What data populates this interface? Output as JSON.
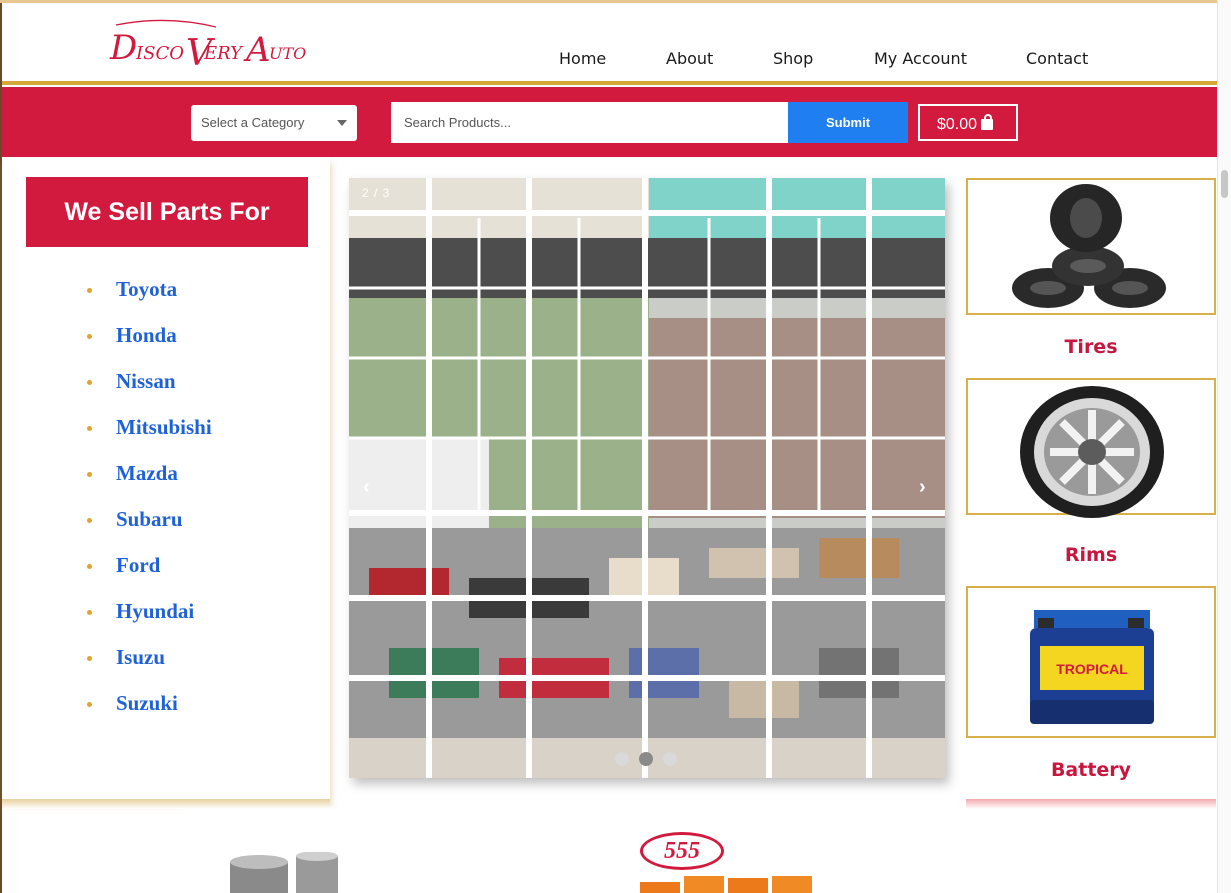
{
  "brand": {
    "logo_text": "DiscoVery Auto",
    "accent": "#d21a3e",
    "gold": "#d4a93a",
    "link": "#1f62d8"
  },
  "nav": {
    "items": [
      "Home",
      "About",
      "Shop",
      "My Account",
      "Contact"
    ]
  },
  "search_bar": {
    "category_select": "Select a Category",
    "search_placeholder": "Search Products...",
    "submit_label": "Submit",
    "cart_total": "$0.00"
  },
  "sidebar": {
    "heading": "We Sell Parts For",
    "brands": [
      "Toyota",
      "Honda",
      "Nissan",
      "Mitsubishi",
      "Mazda",
      "Subaru",
      "Ford",
      "Hyundai",
      "Isuzu",
      "Suzuki"
    ]
  },
  "slider": {
    "counter": "2 / 3",
    "prev_icon": "chevron-left-icon",
    "next_icon": "chevron-right-icon",
    "active_slide": 2,
    "total_slides": 3
  },
  "categories": [
    {
      "label": "Tires",
      "icon": "tire-stack-image"
    },
    {
      "label": "Rims",
      "icon": "chrome-rim-image"
    },
    {
      "label": "Battery",
      "icon": "car-battery-image",
      "battery_brand": "TROPICAL"
    }
  ],
  "bottom": {
    "badge_text": "555"
  }
}
